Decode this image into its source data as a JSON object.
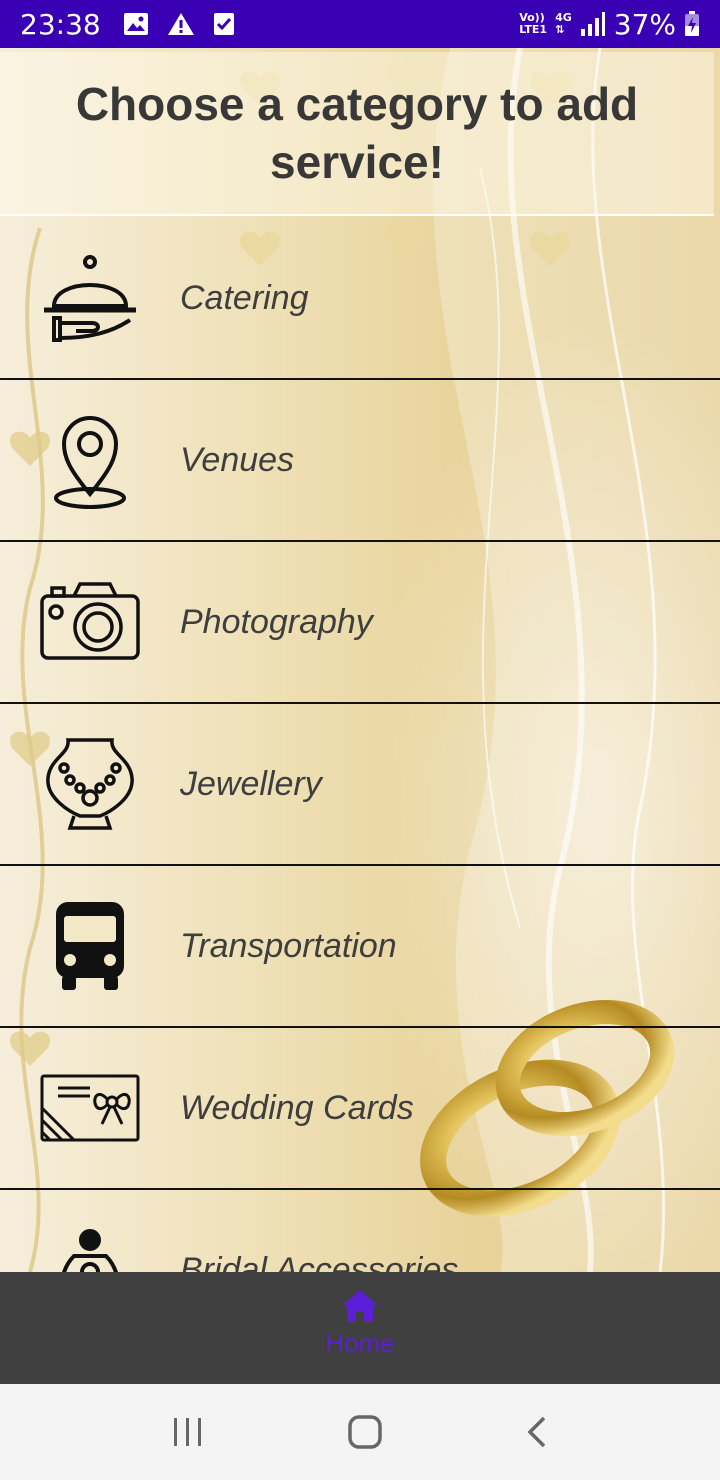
{
  "status_bar": {
    "time": "23:38",
    "network_top": "Vo))",
    "network_bottom": "LTE1",
    "network_gen": "4G",
    "battery": "37%"
  },
  "header": {
    "title": "Choose a category to add service!"
  },
  "categories": [
    {
      "label": "Catering",
      "icon": "catering-cloche-icon"
    },
    {
      "label": "Venues",
      "icon": "location-pin-icon"
    },
    {
      "label": "Photography",
      "icon": "camera-icon"
    },
    {
      "label": "Jewellery",
      "icon": "necklace-icon"
    },
    {
      "label": "Transportation",
      "icon": "bus-icon"
    },
    {
      "label": "Wedding Cards",
      "icon": "invitation-card-icon"
    },
    {
      "label": "Bridal Accessories",
      "icon": "bride-icon"
    }
  ],
  "bottom_nav": {
    "home_label": "Home",
    "active_color": "#5a1fd6"
  },
  "colors": {
    "status_bar": "#3a00b4",
    "nav_background": "#404040"
  }
}
